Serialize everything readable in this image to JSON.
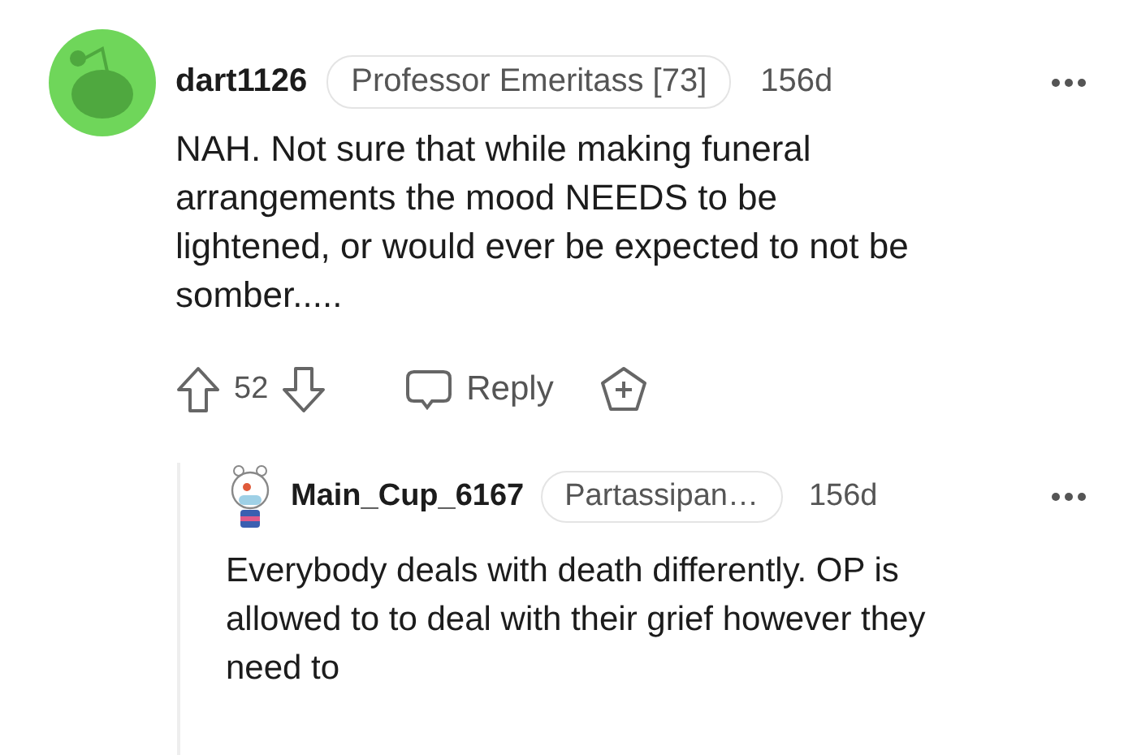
{
  "comment": {
    "username": "dart1126",
    "flair": "Professor Emeritass [73]",
    "age": "156d",
    "body": "NAH. Not sure that while making funeral arrangements the mood NEEDS to be lightened, or would ever be expected to not be somber.....",
    "score": "52",
    "reply_label": "Reply"
  },
  "reply": {
    "username": "Main_Cup_6167",
    "flair": "Partassipan…",
    "age": "156d",
    "body": "Everybody deals with death differently. OP is allowed to to deal with their grief however they need to"
  }
}
